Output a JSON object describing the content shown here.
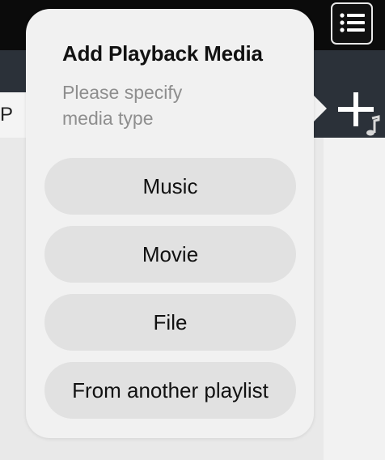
{
  "popover": {
    "title": "Add Playback Media",
    "subtitle_line1": "Please specify",
    "subtitle_line2": "media type",
    "options": [
      "Music",
      "Movie",
      "File",
      "From another playlist"
    ]
  },
  "background": {
    "tab_fragment": "P"
  },
  "icons": {
    "menu": "list-menu-icon",
    "add_music": "add-music-icon"
  },
  "colors": {
    "popover_bg": "#f1f1f1",
    "option_bg": "#e1e1e1",
    "subtitle": "#8e8e8e"
  }
}
